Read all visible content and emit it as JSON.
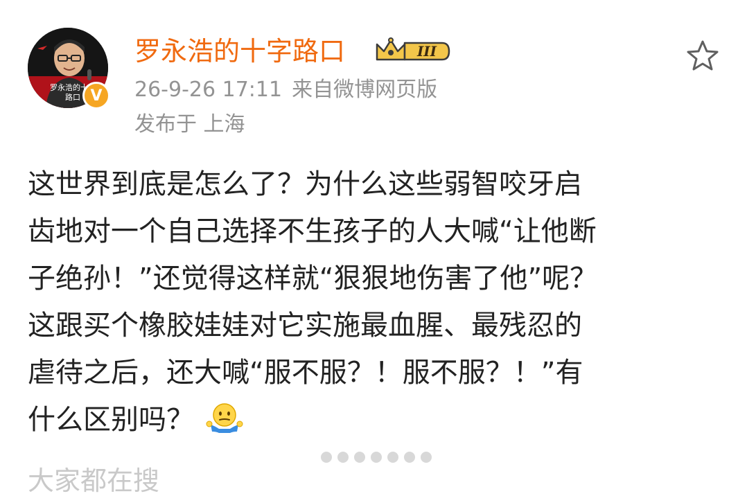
{
  "author": {
    "name": "罗永浩的十字路口",
    "avatar_caption": "罗永浩的十字路口",
    "verified_icon": "v-verified-icon",
    "vip_level_label": "III"
  },
  "meta": {
    "timestamp": "26-9-26 17:11",
    "source": "来自微博网页版",
    "location": "发布于 上海"
  },
  "actions": {
    "favorite_icon": "star-outline-icon"
  },
  "post": {
    "lines": [
      "这世界到底是怎么了？为什么这些弱智咬牙启",
      "齿地对一个自己选择不生孩子的人大喊“让他断",
      "子绝孙！”还觉得这样就“狠狠地伤害了他”呢？",
      "这跟买个橡胶娃娃对它实施最血腥、最残忍的",
      "虐待之后，还大喊“服不服？！服不服？！”有",
      "什么区别吗？"
    ],
    "trailing_emoji": "shrug-emoji-icon"
  },
  "image_pager": {
    "count": 7
  },
  "footer_partial": "大家都在搜"
}
